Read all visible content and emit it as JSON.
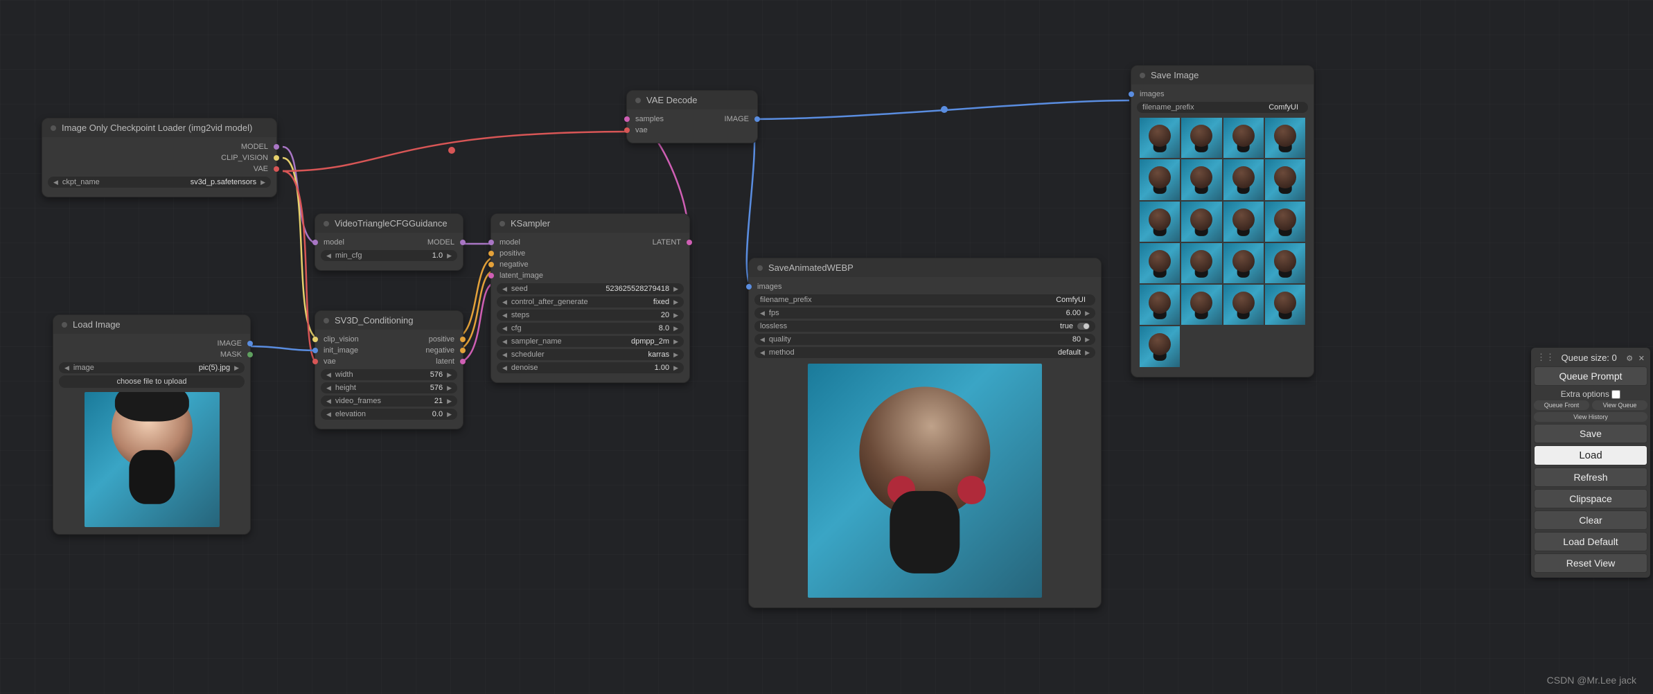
{
  "nodes": {
    "loader": {
      "title": "Image Only Checkpoint Loader (img2vid model)",
      "outputs": [
        "MODEL",
        "CLIP_VISION",
        "VAE"
      ],
      "ckpt_label": "ckpt_name",
      "ckpt_value": "sv3d_p.safetensors"
    },
    "load_image": {
      "title": "Load Image",
      "outputs": [
        "IMAGE",
        "MASK"
      ],
      "image_label": "image",
      "image_value": "pic(5).jpg",
      "upload_label": "choose file to upload"
    },
    "cfgguide": {
      "title": "VideoTriangleCFGGuidance",
      "in": [
        "model"
      ],
      "out": [
        "MODEL"
      ],
      "min_cfg_label": "min_cfg",
      "min_cfg_value": "1.0"
    },
    "sv3d": {
      "title": "SV3D_Conditioning",
      "in": [
        "clip_vision",
        "init_image",
        "vae"
      ],
      "out": [
        "positive",
        "negative",
        "latent"
      ],
      "params": [
        {
          "label": "width",
          "value": "576"
        },
        {
          "label": "height",
          "value": "576"
        },
        {
          "label": "video_frames",
          "value": "21"
        },
        {
          "label": "elevation",
          "value": "0.0"
        }
      ]
    },
    "ksampler": {
      "title": "KSampler",
      "in": [
        "model",
        "positive",
        "negative",
        "latent_image"
      ],
      "out": [
        "LATENT"
      ],
      "params": [
        {
          "label": "seed",
          "value": "523625528279418"
        },
        {
          "label": "control_after_generate",
          "value": "fixed"
        },
        {
          "label": "steps",
          "value": "20"
        },
        {
          "label": "cfg",
          "value": "8.0"
        },
        {
          "label": "sampler_name",
          "value": "dpmpp_2m"
        },
        {
          "label": "scheduler",
          "value": "karras"
        },
        {
          "label": "denoise",
          "value": "1.00"
        }
      ]
    },
    "vae_decode": {
      "title": "VAE Decode",
      "in": [
        "samples",
        "vae"
      ],
      "out": [
        "IMAGE"
      ]
    },
    "save_webp": {
      "title": "SaveAnimatedWEBP",
      "in": [
        "images"
      ],
      "params": [
        {
          "label": "filename_prefix",
          "value": "ComfyUI"
        },
        {
          "label": "fps",
          "value": "6.00"
        },
        {
          "label": "lossless",
          "value": "true"
        },
        {
          "label": "quality",
          "value": "80"
        },
        {
          "label": "method",
          "value": "default"
        }
      ]
    },
    "save_image": {
      "title": "Save Image",
      "in": [
        "images"
      ],
      "prefix_label": "filename_prefix",
      "prefix_value": "ComfyUI"
    }
  },
  "panel": {
    "queue_size": "Queue size: 0",
    "queue_prompt": "Queue Prompt",
    "extra_options": "Extra options",
    "queue_front": "Queue Front",
    "view_queue": "View Queue",
    "view_history": "View History",
    "buttons": [
      "Save",
      "Load",
      "Refresh",
      "Clipspace",
      "Clear",
      "Load Default",
      "Reset View"
    ]
  },
  "watermark": "CSDN @Mr.Lee jack"
}
